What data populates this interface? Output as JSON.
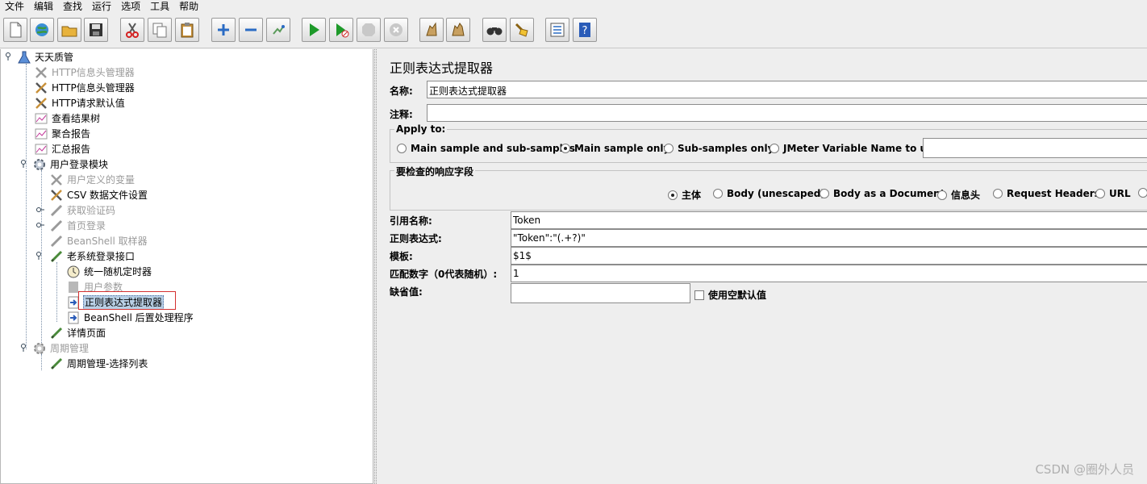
{
  "menu": [
    "文件",
    "编辑",
    "查找",
    "运行",
    "选项",
    "工具",
    "帮助"
  ],
  "toolbar_icons": [
    "new-icon",
    "templates-icon",
    "open-icon",
    "save-icon",
    "cut-icon",
    "copy-icon",
    "paste-icon",
    "expand-icon",
    "collapse-icon",
    "toggle-icon",
    "start-icon",
    "start-no-pause-icon",
    "stop-icon",
    "shutdown-icon",
    "clear-icon",
    "clear-all-icon",
    "search-icon",
    "reset-search-icon",
    "function-helper-icon",
    "help-icon"
  ],
  "tree": [
    {
      "label": "天天质管",
      "disabled": false
    },
    {
      "label": "HTTP信息头管理器",
      "disabled": true
    },
    {
      "label": "HTTP信息头管理器",
      "disabled": false
    },
    {
      "label": "HTTP请求默认值",
      "disabled": false
    },
    {
      "label": "查看结果树",
      "disabled": false
    },
    {
      "label": "聚合报告",
      "disabled": false
    },
    {
      "label": "汇总报告",
      "disabled": false
    },
    {
      "label": "用户登录模块",
      "disabled": false
    },
    {
      "label": "用户定义的变量",
      "disabled": true
    },
    {
      "label": "CSV 数据文件设置",
      "disabled": false
    },
    {
      "label": "获取验证码",
      "disabled": true
    },
    {
      "label": "首页登录",
      "disabled": true
    },
    {
      "label": "BeanShell 取样器",
      "disabled": true
    },
    {
      "label": "老系统登录接口",
      "disabled": false
    },
    {
      "label": "统一随机定时器",
      "disabled": false
    },
    {
      "label": "用户参数",
      "disabled": true
    },
    {
      "label": "正则表达式提取器",
      "disabled": false,
      "selected": true
    },
    {
      "label": "BeanShell 后置处理程序",
      "disabled": false
    },
    {
      "label": "详情页面",
      "disabled": false
    },
    {
      "label": "周期管理",
      "disabled": true
    },
    {
      "label": "周期管理-选择列表",
      "disabled": false
    }
  ],
  "panel": {
    "title": "正则表达式提取器",
    "name_label": "名称:",
    "name_value": "正则表达式提取器",
    "comment_label": "注释:",
    "comment_value": "",
    "apply_to": {
      "title": "Apply to:",
      "options": [
        "Main sample and sub-samples",
        "Main sample only",
        "Sub-samples only",
        "JMeter Variable Name to use"
      ],
      "selected": 1,
      "var_value": ""
    },
    "field_check": {
      "title": "要检查的响应字段",
      "options": [
        "主体",
        "Body (unescaped)",
        "Body as a Document",
        "信息头",
        "Request Headers",
        "URL"
      ],
      "selected": 0
    },
    "ref_label": "引用名称:",
    "ref_value": "Token",
    "regex_label": "正则表达式:",
    "regex_value": "\"Token\":\"(.+?)\"",
    "template_label": "模板:",
    "template_value": "$1$",
    "match_label": "匹配数字（0代表随机）:",
    "match_value": "1",
    "default_label": "缺省值:",
    "default_value": "",
    "empty_default_label": "使用空默认值"
  },
  "watermark": "CSDN @圈外人员"
}
